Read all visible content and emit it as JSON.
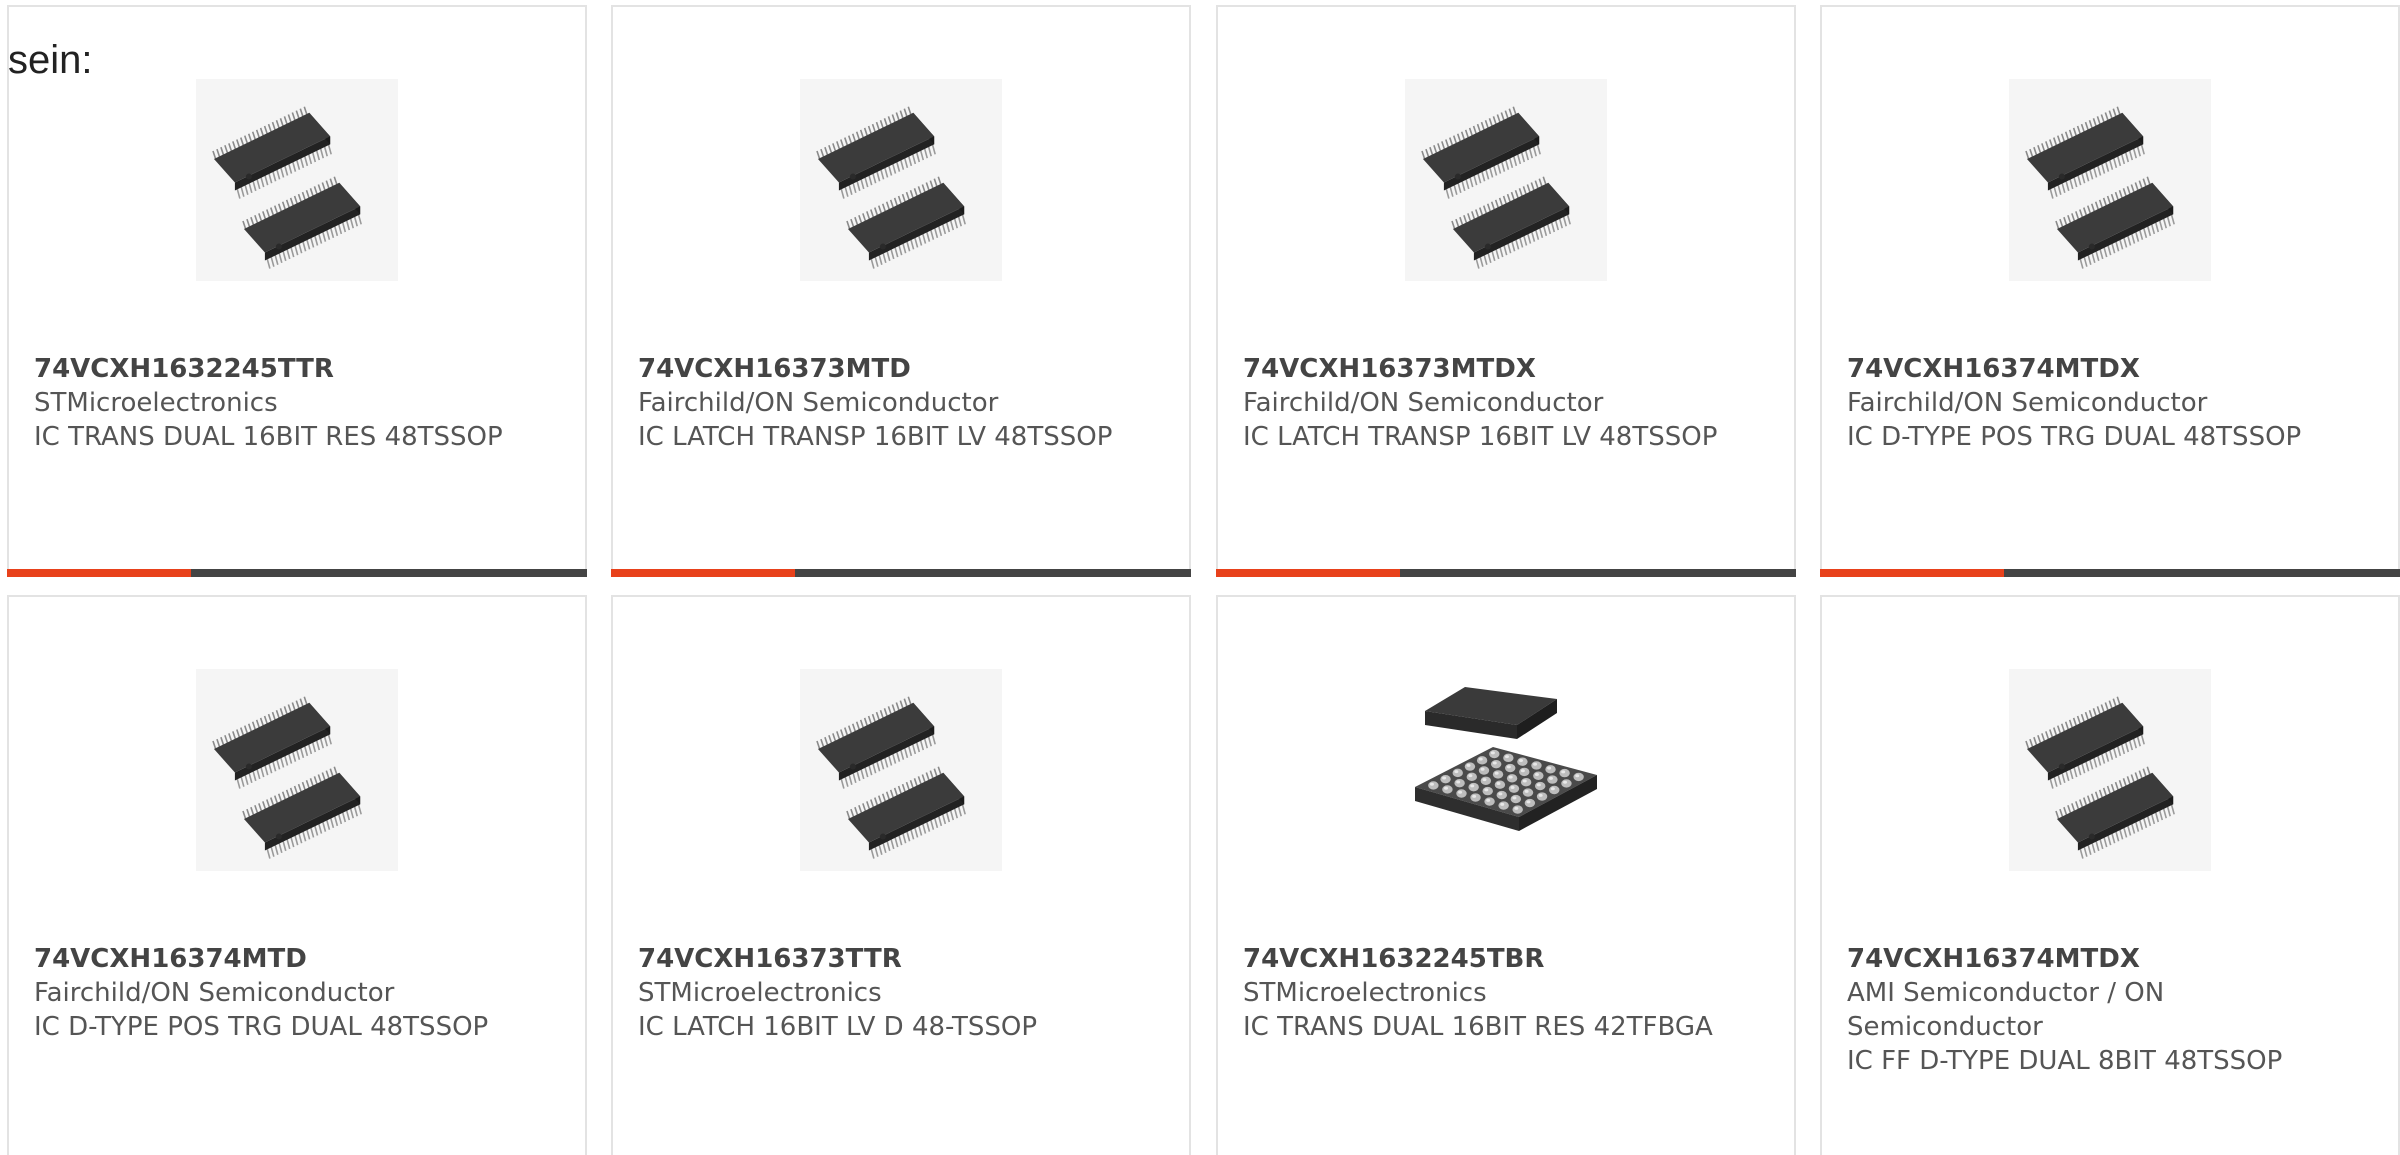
{
  "intro_text": "sein:",
  "accent_color": "#e8411b",
  "cards": [
    {
      "part": "74VCXH1632245TTR",
      "maker": "STMicroelectronics",
      "desc": "IC TRANS DUAL 16BIT RES 48TSSOP",
      "image": "tssop-package-image"
    },
    {
      "part": "74VCXH16373MTD",
      "maker": "Fairchild/ON Semiconductor",
      "desc": "IC LATCH TRANSP 16BIT LV 48TSSOP",
      "image": "tssop-package-image"
    },
    {
      "part": "74VCXH16373MTDX",
      "maker": "Fairchild/ON Semiconductor",
      "desc": "IC LATCH TRANSP 16BIT LV 48TSSOP",
      "image": "tssop-package-image"
    },
    {
      "part": "74VCXH16374MTDX",
      "maker": "Fairchild/ON Semiconductor",
      "desc": "IC D-TYPE POS TRG DUAL 48TSSOP",
      "image": "tssop-package-image"
    },
    {
      "part": "74VCXH16374MTD",
      "maker": "Fairchild/ON Semiconductor",
      "desc": "IC D-TYPE POS TRG DUAL 48TSSOP",
      "image": "tssop-package-image"
    },
    {
      "part": "74VCXH16373TTR",
      "maker": "STMicroelectronics",
      "desc": "IC LATCH 16BIT LV D 48-TSSOP",
      "image": "tssop-package-image"
    },
    {
      "part": "74VCXH1632245TBR",
      "maker": "STMicroelectronics",
      "desc": "IC TRANS DUAL 16BIT RES 42TFBGA",
      "image": "bga-package-image"
    },
    {
      "part": "74VCXH16374MTDX",
      "maker": "AMI Semiconductor / ON Semiconductor",
      "desc": "IC FF D-TYPE DUAL 8BIT 48TSSOP",
      "image": "tssop-package-image"
    }
  ]
}
